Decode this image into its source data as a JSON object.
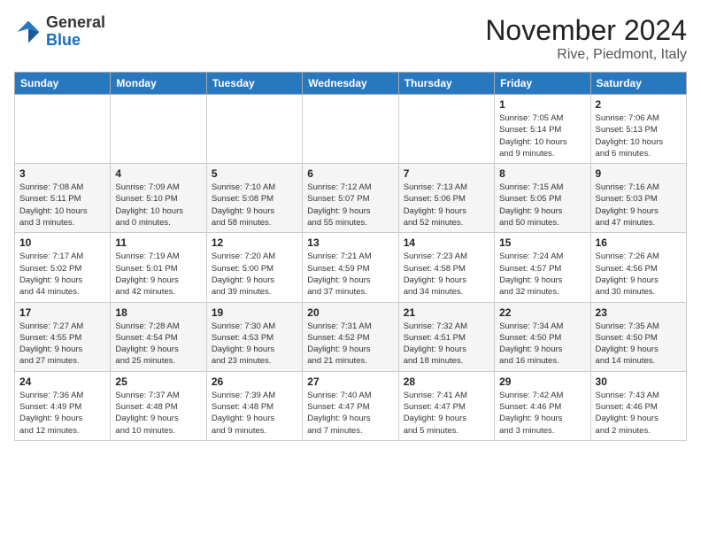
{
  "logo": {
    "general": "General",
    "blue": "Blue"
  },
  "header": {
    "month": "November 2024",
    "location": "Rive, Piedmont, Italy"
  },
  "columns": [
    "Sunday",
    "Monday",
    "Tuesday",
    "Wednesday",
    "Thursday",
    "Friday",
    "Saturday"
  ],
  "weeks": [
    [
      {
        "day": "",
        "info": ""
      },
      {
        "day": "",
        "info": ""
      },
      {
        "day": "",
        "info": ""
      },
      {
        "day": "",
        "info": ""
      },
      {
        "day": "",
        "info": ""
      },
      {
        "day": "1",
        "info": "Sunrise: 7:05 AM\nSunset: 5:14 PM\nDaylight: 10 hours\nand 9 minutes."
      },
      {
        "day": "2",
        "info": "Sunrise: 7:06 AM\nSunset: 5:13 PM\nDaylight: 10 hours\nand 6 minutes."
      }
    ],
    [
      {
        "day": "3",
        "info": "Sunrise: 7:08 AM\nSunset: 5:11 PM\nDaylight: 10 hours\nand 3 minutes."
      },
      {
        "day": "4",
        "info": "Sunrise: 7:09 AM\nSunset: 5:10 PM\nDaylight: 10 hours\nand 0 minutes."
      },
      {
        "day": "5",
        "info": "Sunrise: 7:10 AM\nSunset: 5:08 PM\nDaylight: 9 hours\nand 58 minutes."
      },
      {
        "day": "6",
        "info": "Sunrise: 7:12 AM\nSunset: 5:07 PM\nDaylight: 9 hours\nand 55 minutes."
      },
      {
        "day": "7",
        "info": "Sunrise: 7:13 AM\nSunset: 5:06 PM\nDaylight: 9 hours\nand 52 minutes."
      },
      {
        "day": "8",
        "info": "Sunrise: 7:15 AM\nSunset: 5:05 PM\nDaylight: 9 hours\nand 50 minutes."
      },
      {
        "day": "9",
        "info": "Sunrise: 7:16 AM\nSunset: 5:03 PM\nDaylight: 9 hours\nand 47 minutes."
      }
    ],
    [
      {
        "day": "10",
        "info": "Sunrise: 7:17 AM\nSunset: 5:02 PM\nDaylight: 9 hours\nand 44 minutes."
      },
      {
        "day": "11",
        "info": "Sunrise: 7:19 AM\nSunset: 5:01 PM\nDaylight: 9 hours\nand 42 minutes."
      },
      {
        "day": "12",
        "info": "Sunrise: 7:20 AM\nSunset: 5:00 PM\nDaylight: 9 hours\nand 39 minutes."
      },
      {
        "day": "13",
        "info": "Sunrise: 7:21 AM\nSunset: 4:59 PM\nDaylight: 9 hours\nand 37 minutes."
      },
      {
        "day": "14",
        "info": "Sunrise: 7:23 AM\nSunset: 4:58 PM\nDaylight: 9 hours\nand 34 minutes."
      },
      {
        "day": "15",
        "info": "Sunrise: 7:24 AM\nSunset: 4:57 PM\nDaylight: 9 hours\nand 32 minutes."
      },
      {
        "day": "16",
        "info": "Sunrise: 7:26 AM\nSunset: 4:56 PM\nDaylight: 9 hours\nand 30 minutes."
      }
    ],
    [
      {
        "day": "17",
        "info": "Sunrise: 7:27 AM\nSunset: 4:55 PM\nDaylight: 9 hours\nand 27 minutes."
      },
      {
        "day": "18",
        "info": "Sunrise: 7:28 AM\nSunset: 4:54 PM\nDaylight: 9 hours\nand 25 minutes."
      },
      {
        "day": "19",
        "info": "Sunrise: 7:30 AM\nSunset: 4:53 PM\nDaylight: 9 hours\nand 23 minutes."
      },
      {
        "day": "20",
        "info": "Sunrise: 7:31 AM\nSunset: 4:52 PM\nDaylight: 9 hours\nand 21 minutes."
      },
      {
        "day": "21",
        "info": "Sunrise: 7:32 AM\nSunset: 4:51 PM\nDaylight: 9 hours\nand 18 minutes."
      },
      {
        "day": "22",
        "info": "Sunrise: 7:34 AM\nSunset: 4:50 PM\nDaylight: 9 hours\nand 16 minutes."
      },
      {
        "day": "23",
        "info": "Sunrise: 7:35 AM\nSunset: 4:50 PM\nDaylight: 9 hours\nand 14 minutes."
      }
    ],
    [
      {
        "day": "24",
        "info": "Sunrise: 7:36 AM\nSunset: 4:49 PM\nDaylight: 9 hours\nand 12 minutes."
      },
      {
        "day": "25",
        "info": "Sunrise: 7:37 AM\nSunset: 4:48 PM\nDaylight: 9 hours\nand 10 minutes."
      },
      {
        "day": "26",
        "info": "Sunrise: 7:39 AM\nSunset: 4:48 PM\nDaylight: 9 hours\nand 9 minutes."
      },
      {
        "day": "27",
        "info": "Sunrise: 7:40 AM\nSunset: 4:47 PM\nDaylight: 9 hours\nand 7 minutes."
      },
      {
        "day": "28",
        "info": "Sunrise: 7:41 AM\nSunset: 4:47 PM\nDaylight: 9 hours\nand 5 minutes."
      },
      {
        "day": "29",
        "info": "Sunrise: 7:42 AM\nSunset: 4:46 PM\nDaylight: 9 hours\nand 3 minutes."
      },
      {
        "day": "30",
        "info": "Sunrise: 7:43 AM\nSunset: 4:46 PM\nDaylight: 9 hours\nand 2 minutes."
      }
    ]
  ]
}
